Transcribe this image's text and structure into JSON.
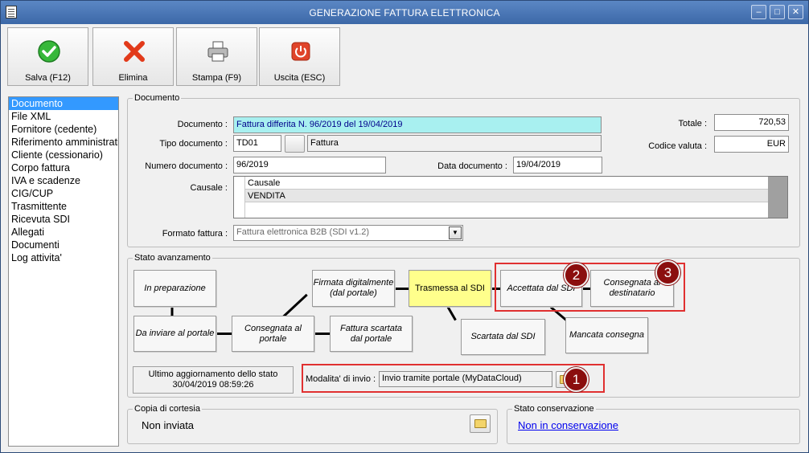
{
  "window": {
    "title": "GENERAZIONE FATTURA ELETTRONICA"
  },
  "toolbar": {
    "save_label": "Salva (F12)",
    "delete_label": "Elimina",
    "print_label": "Stampa (F9)",
    "exit_label": "Uscita (ESC)"
  },
  "sidebar": {
    "items": [
      {
        "label": "Documento"
      },
      {
        "label": "File XML"
      },
      {
        "label": "Fornitore (cedente)"
      },
      {
        "label": "Riferimento amministrativo"
      },
      {
        "label": "Cliente (cessionario)"
      },
      {
        "label": "Corpo fattura"
      },
      {
        "label": "IVA e scadenze"
      },
      {
        "label": "CIG/CUP"
      },
      {
        "label": "Trasmittente"
      },
      {
        "label": "Ricevuta SDI"
      },
      {
        "label": "Allegati"
      },
      {
        "label": "Documenti"
      },
      {
        "label": "Log attivita'"
      }
    ]
  },
  "documento": {
    "group_title": "Documento",
    "documento_label": "Documento :",
    "documento_value": "Fattura differita N. 96/2019 del 19/04/2019",
    "tipo_label": "Tipo documento :",
    "tipo_code": "TD01",
    "tipo_desc": "Fattura",
    "numero_label": "Numero documento :",
    "numero_value": "96/2019",
    "data_label": "Data documento :",
    "data_value": "19/04/2019",
    "totale_label": "Totale :",
    "totale_value": "720,53",
    "valuta_label": "Codice valuta :",
    "valuta_value": "EUR",
    "causale_label": "Causale :",
    "causale_header": "Causale",
    "causale_rows": [
      "VENDITA"
    ],
    "formato_label": "Formato fattura :",
    "formato_value": "Fattura elettronica B2B (SDI v1.2)"
  },
  "stato": {
    "group_title": "Stato avanzamento",
    "stages": {
      "in_preparazione": "In preparazione",
      "da_inviare": "Da inviare al portale",
      "consegnata_portale": "Consegnata al portale",
      "firmata": "Firmata digitalmente (dal portale)",
      "scartata_portale": "Fattura scartata dal portale",
      "trasmessa": "Trasmessa al SDI",
      "scartata_sdi": "Scartata dal SDI",
      "accettata": "Accettata dal SDI",
      "consegnata_dest": "Consegnata al destinatario",
      "mancata": "Mancata consegna"
    },
    "ultimo_label": "Ultimo aggiornamento dello stato",
    "ultimo_value": "30/04/2019 08:59:26",
    "modalita_label": "Modalita' di invio :",
    "modalita_value": "Invio tramite portale (MyDataCloud)",
    "badges": [
      "1",
      "2",
      "3"
    ]
  },
  "cortesia": {
    "group_title": "Copia di cortesia",
    "value": "Non inviata"
  },
  "conservazione": {
    "group_title": "Stato conservazione",
    "link": "Non in conservazione"
  },
  "colors": {
    "title_bar": "#3c68a8",
    "current_stage": "#ffff8c",
    "highlight": "#e03030",
    "badge": "#8b0e0e",
    "selected": "#3399ff"
  }
}
